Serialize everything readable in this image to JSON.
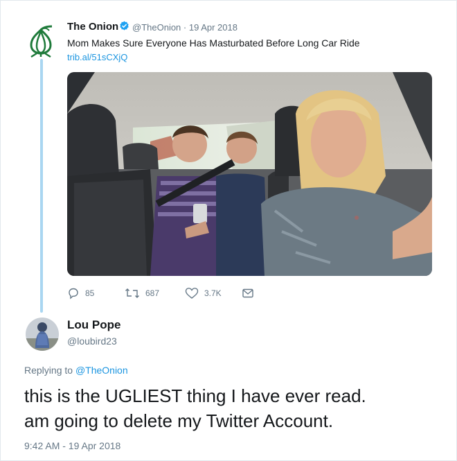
{
  "tweet": {
    "author_name": "The Onion",
    "author_handle": "@TheOnion",
    "date_sep": " · ",
    "date": "19 Apr 2018",
    "text": "Mom Makes Sure Everyone Has Masturbated Before Long Car Ride",
    "link": "trib.al/51sCXjQ",
    "stats": {
      "replies": "85",
      "retweets": "687",
      "likes": "3.7K"
    },
    "photo_icon": "car-interior-photo"
  },
  "reply": {
    "author_name": "Lou Pope",
    "author_handle": "@loubird23",
    "replying_prefix": "Replying to ",
    "replying_to": "@TheOnion",
    "line1": "this is the UGLIEST thing I have ever read.",
    "line2": "am going to delete my Twitter Account.",
    "timestamp": "9:42 AM - 19 Apr 2018"
  },
  "colors": {
    "brand_green": "#1e7a3a",
    "link_blue": "#1b95e0",
    "thread_line": "#a9d6f1",
    "muted": "#657786"
  }
}
